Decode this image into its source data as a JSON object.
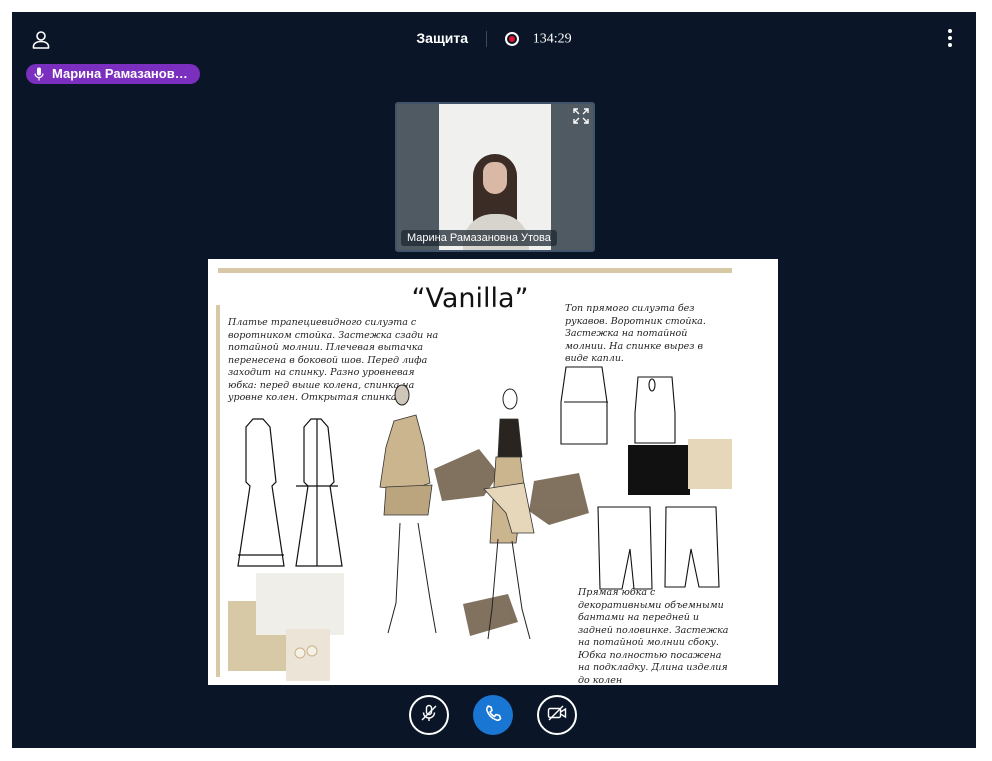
{
  "header": {
    "title": "Защита",
    "timer": "134:29",
    "user_icon": "user-icon",
    "more_icon": "more-vertical-icon",
    "record_color": "#e0162b"
  },
  "speaker": {
    "name": "Марина Рамазанов…",
    "color": "#7b2fbf",
    "icon": "microphone-icon"
  },
  "video": {
    "participant_name": "Марина Рамазановна Утова",
    "expand_icon": "fullscreen-icon"
  },
  "slide": {
    "title": "“Vanilla”",
    "text_left": "Платье трапециевидного силуэта с воротником стойка. Застежка сзади на потайной молнии. Плечевая вытачка перенесена в боковой шов. Перед лифа заходит на спинку. Разно уровневая юбка: перед выше колена, спинка на уровне колен. Открытая спинка.",
    "text_right_top": "Топ прямого силуэта без рукавов. Воротник стойка. Застежка на потайной молнии. На спинке вырез в виде капли.",
    "text_right_bottom": "Прямая юбка с декоративными объемными бантами на передней и задней половинке. Застежка на потайной молнии сбоку. Юбка полностью посажена на подкладку. Длина изделия до колен",
    "palette": {
      "cream": "#e6d7bb",
      "beige": "#cbb58f",
      "brown": "#7a6a56",
      "black": "#111111",
      "accent": "#d8c9a6"
    }
  },
  "controls": {
    "mute_icon": "microphone-off-icon",
    "call_icon": "phone-icon",
    "camera_icon": "camera-off-icon",
    "call_color": "#1976d2"
  },
  "colors": {
    "background": "#0a1628",
    "text": "#ffffff"
  }
}
